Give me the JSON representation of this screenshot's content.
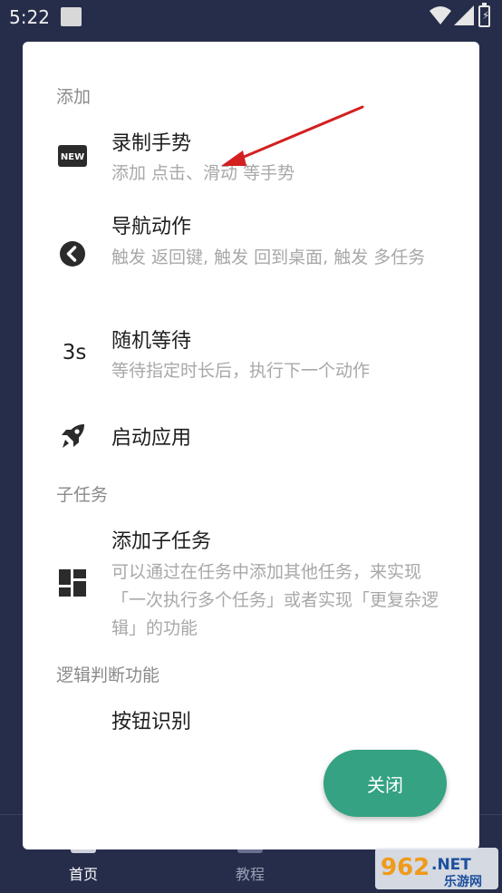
{
  "status": {
    "time": "5:22"
  },
  "bottom_nav": {
    "home": "首页",
    "tutorial": "教程"
  },
  "watermark": {
    "brand": "962.NET",
    "sub": "乐游网"
  },
  "dialog": {
    "section_add": "添加",
    "items": [
      {
        "title": "录制手势",
        "desc": "添加 点击、滑动 等手势",
        "icon": "new-badge-icon"
      },
      {
        "title": "导航动作",
        "desc": "触发 返回键, 触发 回到桌面, 触发 多任务",
        "icon": "back-circle-icon"
      },
      {
        "title": "随机等待",
        "desc": "等待指定时长后，执行下一个动作",
        "icon": "3s-timer-icon",
        "icon_text": "3s"
      },
      {
        "title": "启动应用",
        "icon": "rocket-icon"
      }
    ],
    "section_subtask": "子任务",
    "subtask_item": {
      "title": "添加子任务",
      "desc": "可以通过在任务中添加其他任务，来实现「一次执行多个任务」或者实现「更复杂逻辑」的功能",
      "icon": "dashboard-grid-icon"
    },
    "section_logic": "逻辑判断功能",
    "logic_item": {
      "title": "按钮识别"
    },
    "close_label": "关闭",
    "accent_color": "#34a283",
    "annotation_color": "#d32020"
  }
}
